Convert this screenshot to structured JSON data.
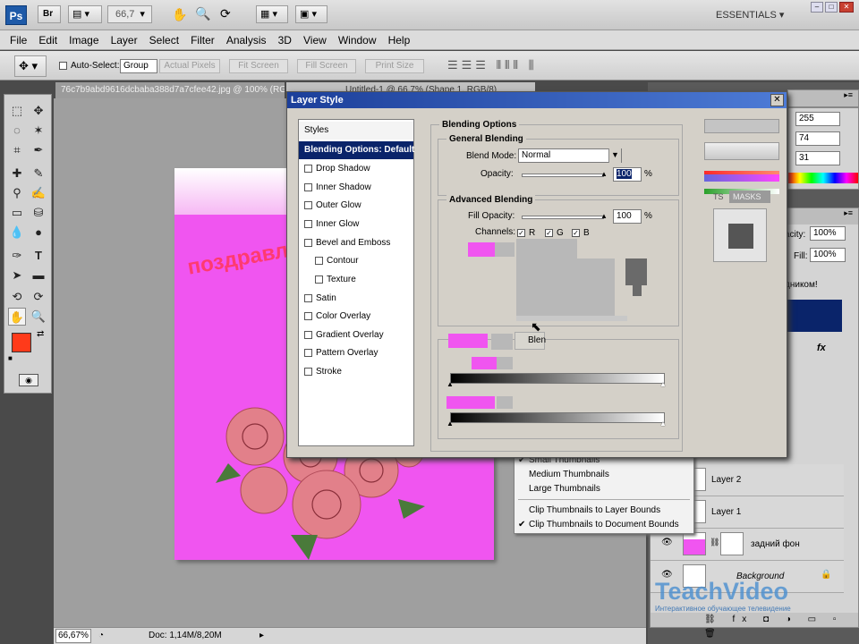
{
  "appbar": {
    "logo": "Ps",
    "zoom": "66,7",
    "workspace": "ESSENTIALS"
  },
  "menu": [
    "File",
    "Edit",
    "Image",
    "Layer",
    "Select",
    "Filter",
    "Analysis",
    "3D",
    "View",
    "Window",
    "Help"
  ],
  "options": {
    "auto_select": "Auto-Select:",
    "group_value": "Group",
    "actual_pixels": "Actual Pixels",
    "fit_screen": "Fit Screen",
    "fill_screen": "Fill Screen",
    "print_size": "Print Size"
  },
  "doc": {
    "tab1": "76c7b9abd9616dcbaba388d7a7cfee42.jpg @ 100% (RGB/8)",
    "tab2": "Untitled-1 @ 66,7% (Shape 1, RGB/8)",
    "canvas_text": "поздравл",
    "zoom_status": "66,67%",
    "doc_status": "Doc: 1,14M/8,20M"
  },
  "colors": {
    "foreground": "#ff3a1a",
    "pink": "#f055f0",
    "dialog_title": "#1c3f9a"
  },
  "dialog": {
    "title": "Layer Style",
    "styles_header": "Styles",
    "style_items": [
      "Blending Options: Default",
      "Drop Shadow",
      "Inner Shadow",
      "Outer Glow",
      "Inner Glow",
      "Bevel and Emboss",
      "Contour",
      "Texture",
      "Satin",
      "Color Overlay",
      "Gradient Overlay",
      "Pattern Overlay",
      "Stroke"
    ],
    "blending_options": "Blending Options",
    "general_blending": "General Blending",
    "blend_mode_label": "Blend Mode:",
    "blend_mode_value": "Normal",
    "opacity_label": "Opacity:",
    "opacity_value": "100",
    "percent": "%",
    "advanced_blending": "Advanced Blending",
    "fill_opacity_label": "Fill Opacity:",
    "fill_opacity_value": "100",
    "channels_label": "Channels:",
    "channel_r": "R",
    "channel_g": "G",
    "channel_b": "B",
    "blend_if_text": "Blen",
    "preview_tabs": [
      "TS",
      "MASKS"
    ]
  },
  "color_panel": {
    "r": "255",
    "g": "74",
    "b": "31"
  },
  "layers_panel": {
    "opacity_label": "acity:",
    "opacity_value": "100%",
    "fill_label": "Fill:",
    "fill_value": "100%",
    "partial_text": "дником!",
    "fx_label": "fx",
    "layers": [
      "Layer 2",
      "Layer 1",
      "задний фон",
      "Background"
    ]
  },
  "context_menu": {
    "items": [
      "Small Thumbnails",
      "Medium Thumbnails",
      "Large Thumbnails",
      "Clip Thumbnails to Layer Bounds",
      "Clip Thumbnails to Document Bounds"
    ]
  },
  "watermark": {
    "brand": "TeachVideo",
    "tagline": "Интерактивное обучающее телевидение"
  }
}
